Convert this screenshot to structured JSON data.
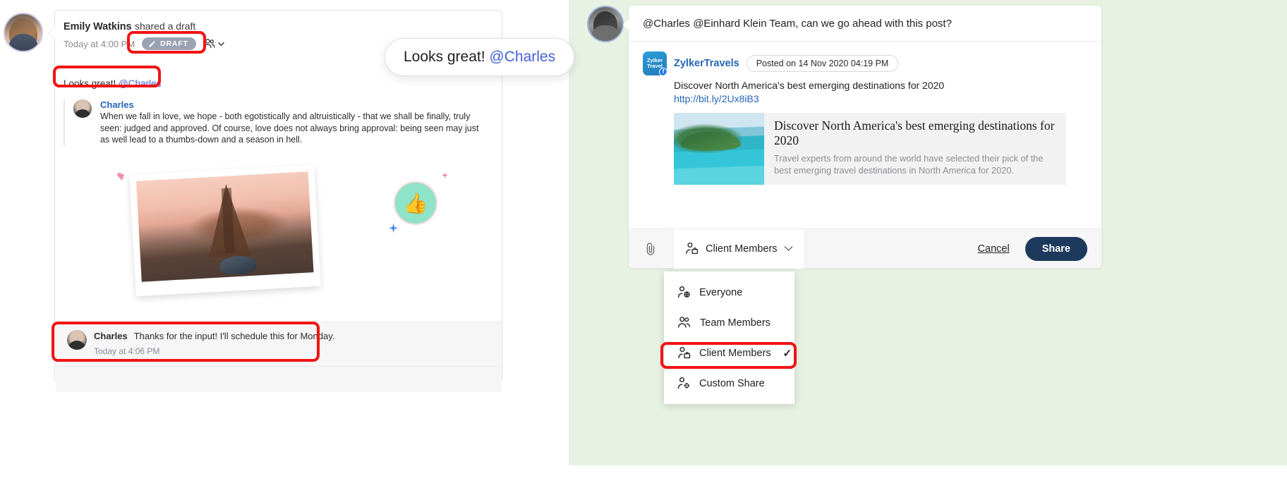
{
  "left_panel": {
    "avatar_name": "Emily Watkins",
    "message": {
      "author": "Emily Watkins",
      "action": "shared a draft",
      "timestamp": "Today at 4:00 PM",
      "draft_badge": "DRAFT",
      "comment": "Looks great! ",
      "comment_mention": "@Charles"
    },
    "quoted_post": {
      "author": "Charles",
      "text": "When we fall in love, we hope - both egotistically and altruistically - that we shall be finally, truly seen: judged and approved. Of course, love does not always bring approval: being seen may just as well lead to a thumbs-down and a season in hell."
    },
    "reaction": "👍",
    "reply": {
      "author": "Charles",
      "text": "Thanks for the input! I'll schedule this for Monday.",
      "timestamp": "Today at 4:06 PM"
    },
    "callout": {
      "text": "Looks great! ",
      "mention": "@Charles"
    }
  },
  "right_panel": {
    "compose_text": "@Charles @Einhard Klein  Team, can we go ahead with this post?",
    "post": {
      "brand": "ZylkerTravels",
      "brand_logo_text": "Zylker Travel",
      "posted_on": "Posted on 14 Nov 2020 04:19 PM",
      "body": "Discover North America's best emerging destinations for 2020",
      "link": "http://bit.ly/2Ux8iB3",
      "preview": {
        "title": "Discover North America's best emerging destinations for 2020",
        "description": "Travel experts from around the world have selected their pick of the best emerging travel destinations in North America for 2020."
      }
    },
    "footer": {
      "attach_icon": "paperclip-icon",
      "audience_label": "Client Members",
      "cancel_label": "Cancel",
      "share_label": "Share"
    },
    "dropdown": {
      "items": [
        {
          "label": "Everyone",
          "icon": "person-globe-icon",
          "selected": false
        },
        {
          "label": "Team Members",
          "icon": "people-icon",
          "selected": false
        },
        {
          "label": "Client Members",
          "icon": "person-briefcase-icon",
          "selected": true
        },
        {
          "label": "Custom Share",
          "icon": "person-gear-icon",
          "selected": false
        }
      ],
      "check_glyph": "✓"
    }
  },
  "colors": {
    "accent_blue": "#2566b8",
    "mention_blue": "#4661d6",
    "share_button": "#1d3a5c",
    "highlight_red": "#f11414",
    "panel_green": "#e7f2e2",
    "draft_badge": "#9aa3b4"
  }
}
